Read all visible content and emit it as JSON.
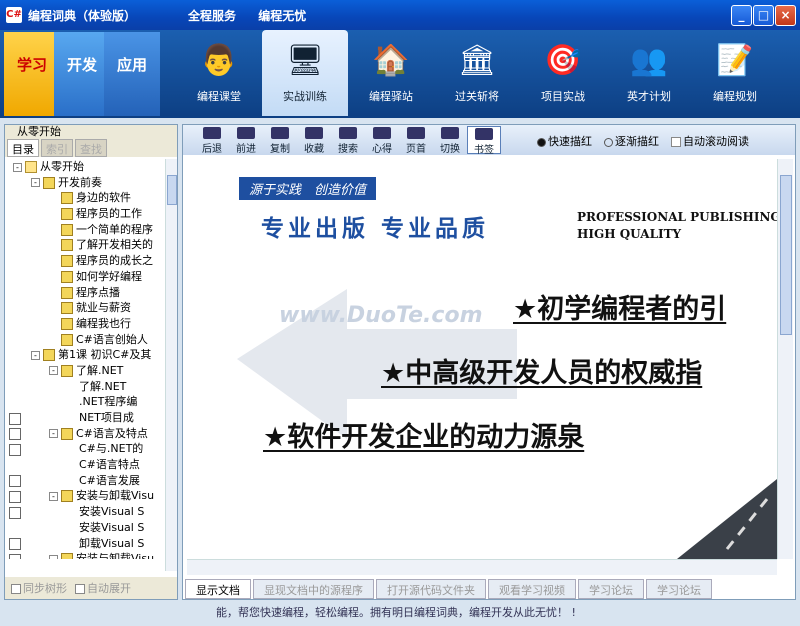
{
  "window": {
    "app_icon": "C#",
    "title": "编程词典（体验版）",
    "nav": [
      "全程服务",
      "编程无忧"
    ],
    "min": "_",
    "max": "□",
    "close": "×"
  },
  "modes": [
    {
      "label": "学习"
    },
    {
      "label": "开发"
    },
    {
      "label": "应用"
    }
  ],
  "tools": [
    {
      "label": "编程课堂",
      "icon": "teacher-icon",
      "glyph": "👨"
    },
    {
      "label": "实战训练",
      "icon": "monitor-icon",
      "glyph": "🖥"
    },
    {
      "label": "编程驿站",
      "icon": "house-icon",
      "glyph": "🏠"
    },
    {
      "label": "过关斩将",
      "icon": "gate-icon",
      "glyph": "🏛"
    },
    {
      "label": "项目实战",
      "icon": "target-icon",
      "glyph": "🎯"
    },
    {
      "label": "英才计划",
      "icon": "people-icon",
      "glyph": "👥"
    },
    {
      "label": "编程规划",
      "icon": "document-icon",
      "glyph": "📝"
    }
  ],
  "left": {
    "title": "从零开始",
    "tabs": [
      {
        "label": "目录"
      },
      {
        "label": "索引"
      },
      {
        "label": "查找"
      }
    ],
    "tree": [
      {
        "label": "从零开始",
        "level": 0,
        "toggle": "-",
        "icon": "folder"
      },
      {
        "label": "开发前奏",
        "level": 1,
        "toggle": "-",
        "icon": "book"
      },
      {
        "label": "身边的软件",
        "level": 2,
        "toggle": "",
        "icon": "book"
      },
      {
        "label": "程序员的工作",
        "level": 2,
        "toggle": "",
        "icon": "book"
      },
      {
        "label": "一个简单的程序",
        "level": 2,
        "toggle": "",
        "icon": "book"
      },
      {
        "label": "了解开发相关的",
        "level": 2,
        "toggle": "",
        "icon": "book"
      },
      {
        "label": "程序员的成长之",
        "level": 2,
        "toggle": "",
        "icon": "book"
      },
      {
        "label": "如何学好编程",
        "level": 2,
        "toggle": "",
        "icon": "book"
      },
      {
        "label": "程序点播",
        "level": 2,
        "toggle": "",
        "icon": "book"
      },
      {
        "label": "就业与薪资",
        "level": 2,
        "toggle": "",
        "icon": "book"
      },
      {
        "label": "编程我也行",
        "level": 2,
        "toggle": "",
        "icon": "book"
      },
      {
        "label": "C#语言创始人",
        "level": 2,
        "toggle": "",
        "icon": "book"
      },
      {
        "label": "第1课  初识C#及其",
        "level": 1,
        "toggle": "-",
        "icon": "book"
      },
      {
        "label": "了解.NET",
        "level": 2,
        "toggle": "-",
        "icon": "book"
      },
      {
        "label": "了解.NET",
        "level": 3,
        "toggle": "",
        "icon": "page"
      },
      {
        "label": ".NET程序编",
        "level": 3,
        "toggle": "",
        "icon": "page"
      },
      {
        "label": "NET项目成",
        "level": 3,
        "toggle": "",
        "icon": "page"
      },
      {
        "label": "C#语言及特点",
        "level": 2,
        "toggle": "-",
        "icon": "book"
      },
      {
        "label": "C#与.NET的",
        "level": 3,
        "toggle": "",
        "icon": "page"
      },
      {
        "label": "C#语言特点",
        "level": 3,
        "toggle": "",
        "icon": "page"
      },
      {
        "label": "C#语言发展",
        "level": 3,
        "toggle": "",
        "icon": "page"
      },
      {
        "label": "安装与卸载Visu",
        "level": 2,
        "toggle": "-",
        "icon": "book"
      },
      {
        "label": "安装Visual S",
        "level": 3,
        "toggle": "",
        "icon": "page"
      },
      {
        "label": "安装Visual S",
        "level": 3,
        "toggle": "",
        "icon": "page"
      },
      {
        "label": "卸载Visual S",
        "level": 3,
        "toggle": "",
        "icon": "page"
      },
      {
        "label": "安装与卸载Visu",
        "level": 2,
        "toggle": "-",
        "icon": "book"
      }
    ],
    "bottom": [
      {
        "label": "同步树形"
      },
      {
        "label": "自动展开"
      }
    ]
  },
  "main": {
    "tools": [
      {
        "label": "后退",
        "icon": "back-icon"
      },
      {
        "label": "前进",
        "icon": "forward-icon"
      },
      {
        "label": "复制",
        "icon": "copy-icon"
      },
      {
        "label": "收藏",
        "icon": "favorite-icon"
      },
      {
        "label": "搜索",
        "icon": "search-icon"
      },
      {
        "label": "心得",
        "icon": "notes-icon"
      },
      {
        "label": "页首",
        "icon": "top-icon"
      },
      {
        "label": "切换",
        "icon": "switch-icon"
      },
      {
        "label": "书签",
        "icon": "bookmark-icon"
      }
    ],
    "options": [
      {
        "label": "快速描红",
        "checked": true
      },
      {
        "label": "逐渐描红",
        "checked": false
      }
    ],
    "auto_scroll": "自动滚动阅读",
    "content": {
      "tag": "源于实践　创造价值",
      "headline": "专业出版  专业品质",
      "en1": "PROFESSIONAL PUBLISHING",
      "en2": "HIGH QUALITY",
      "watermark": "www.DuoTe.com",
      "slogans": [
        "★初学编程者的引",
        "★中高级开发人员的权威指",
        "★软件开发企业的动力源泉"
      ]
    },
    "bottom_tabs": [
      {
        "label": "显示文档"
      },
      {
        "label": "显现文档中的源程序"
      },
      {
        "label": "打开源代码文件夹"
      },
      {
        "label": "观看学习视频"
      },
      {
        "label": "学习论坛"
      },
      {
        "label": "学习论坛"
      }
    ]
  },
  "status": "能，帮您快速编程，轻松编程。拥有明日编程词典，编程开发从此无忧！ !"
}
